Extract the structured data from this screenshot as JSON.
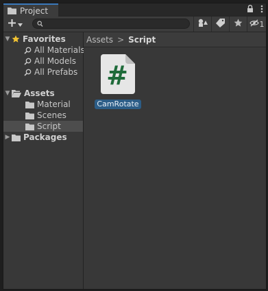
{
  "window": {
    "tab_title": "Project",
    "tab_icons": [
      "folder-icon"
    ],
    "menu_icons": [
      "lock-icon",
      "kebab-menu-icon"
    ]
  },
  "toolbar": {
    "add_label": "+",
    "search_placeholder": "",
    "hidden_count": "1",
    "icons": [
      "search-by-type-icon",
      "label-icon",
      "favorite-star-icon",
      "hidden-packages-icon"
    ]
  },
  "tree": {
    "favorites": {
      "label": "Favorites",
      "items": [
        "All Materials",
        "All Models",
        "All Prefabs"
      ]
    },
    "assets": {
      "label": "Assets",
      "items": [
        "Material",
        "Scenes",
        "Script"
      ],
      "selected": "Script"
    },
    "packages": {
      "label": "Packages"
    }
  },
  "breadcrumb": {
    "items": [
      "Assets",
      "Script"
    ],
    "separator": ">"
  },
  "assets_grid": {
    "items": [
      {
        "name": "CamRotate",
        "type": "C# script",
        "glyph": "#"
      }
    ]
  },
  "colors": {
    "panel_bg": "#383838",
    "selection_blue": "#2c5d87",
    "tab_accent": "#3a79bb",
    "script_icon_green": "#1f6b3a"
  }
}
